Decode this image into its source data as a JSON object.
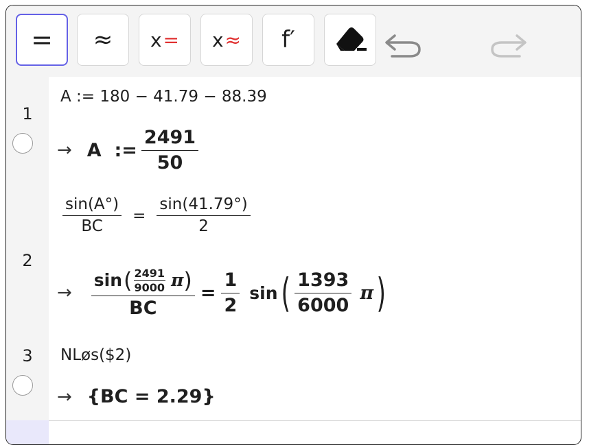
{
  "toolbar": {
    "exact_label": "=",
    "numeric_label": "≈",
    "solve_x_label": "x",
    "solve_x_eq": "=",
    "nsolve_x_label": "x",
    "nsolve_x_eq": "≈",
    "derivative_label": "f′",
    "accent_color": "#6461e6",
    "red_color": "#e03131"
  },
  "rows": [
    {
      "number": "1",
      "input": "A :=  180 − 41.79 − 88.39",
      "output": {
        "lhs": "A  :=",
        "num": "2491",
        "den": "50"
      }
    },
    {
      "number": "2",
      "input": {
        "left_num": "sin(A°)",
        "left_den": "BC",
        "equals": "=",
        "right_num": "sin(41.79°)",
        "right_den": "2"
      },
      "output": {
        "sin_open": "sin",
        "inner_num": "2491",
        "inner_den": "9000",
        "pi": "π",
        "den": "BC",
        "equals": "=",
        "half_num": "1",
        "half_den": "2",
        "sin2": "sin",
        "arg_num": "1393",
        "arg_den": "6000",
        "pi2": "π"
      }
    },
    {
      "number": "3",
      "input": "NLøs($2)",
      "output": "{BC = 2.29}"
    }
  ],
  "arrow": "→"
}
